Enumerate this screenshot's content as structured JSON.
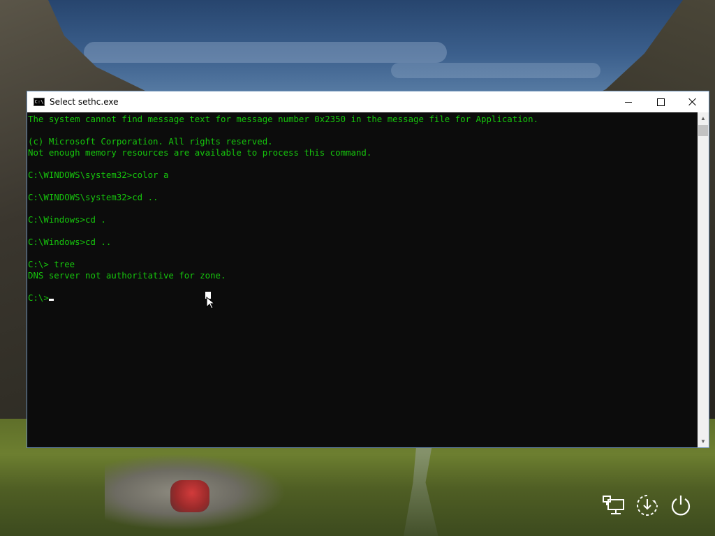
{
  "window": {
    "title": "Select sethc.exe",
    "icon": "cmd-icon",
    "icon_text": "C:\\"
  },
  "console": {
    "text_color": "#16c60c",
    "background_color": "#0c0c0c",
    "lines": [
      "The system cannot find message text for message number 0x2350 in the message file for Application.",
      "",
      "(c) Microsoft Corporation. All rights reserved.",
      "Not enough memory resources are available to process this command.",
      "",
      "C:\\WINDOWS\\system32>color a",
      "",
      "C:\\WINDOWS\\system32>cd ..",
      "",
      "C:\\Windows>cd .",
      "",
      "C:\\Windows>cd ..",
      "",
      "C:\\> tree",
      "DNS server not authoritative for zone.",
      "",
      "C:\\>"
    ]
  },
  "taskbar_icons": [
    "network-icon",
    "ease-of-access-icon",
    "power-icon"
  ]
}
